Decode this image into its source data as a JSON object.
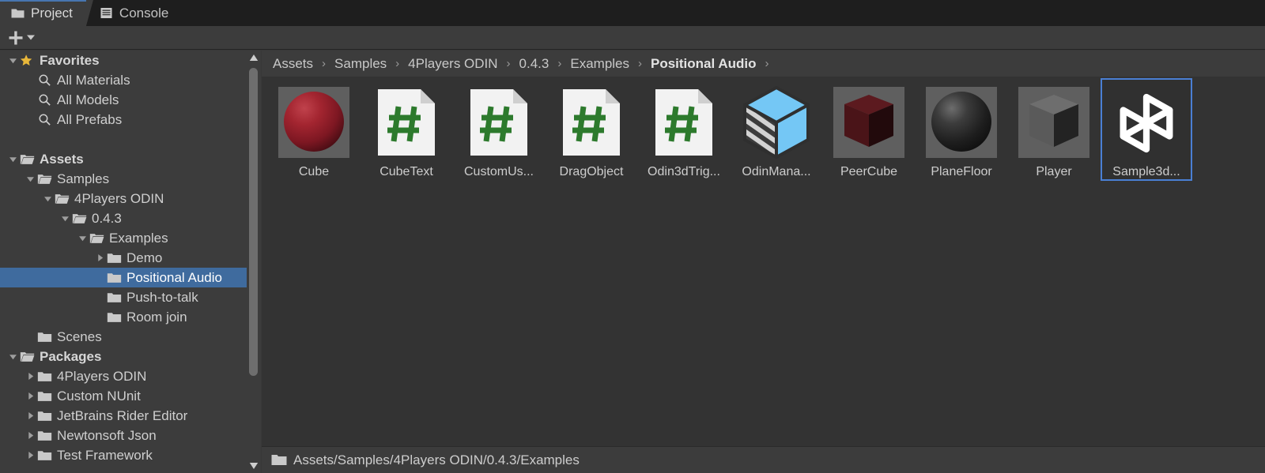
{
  "window": {
    "tabs": [
      {
        "label": "Project",
        "icon": "folder-icon",
        "active": true
      },
      {
        "label": "Console",
        "icon": "console-icon",
        "active": false
      }
    ]
  },
  "toolbar": {
    "add_label": "+",
    "add_icon": "plus-icon",
    "dropdown_icon": "chevron-down-icon",
    "search": {
      "value": "",
      "placeholder": "",
      "icon": "search-icon"
    }
  },
  "tree": {
    "items": [
      {
        "label": "Favorites",
        "indent": 0,
        "arrow": "down",
        "icon": "star-icon",
        "bold": true,
        "selected": false
      },
      {
        "label": "All Materials",
        "indent": 1,
        "arrow": "none",
        "icon": "search-icon",
        "bold": false,
        "selected": false
      },
      {
        "label": "All Models",
        "indent": 1,
        "arrow": "none",
        "icon": "search-icon",
        "bold": false,
        "selected": false
      },
      {
        "label": "All Prefabs",
        "indent": 1,
        "arrow": "none",
        "icon": "search-icon",
        "bold": false,
        "selected": false
      },
      {
        "label": "",
        "indent": 0,
        "arrow": "none",
        "icon": "none",
        "bold": false,
        "selected": false
      },
      {
        "label": "Assets",
        "indent": 0,
        "arrow": "down",
        "icon": "folder-open-icon",
        "bold": true,
        "selected": false
      },
      {
        "label": "Samples",
        "indent": 1,
        "arrow": "down",
        "icon": "folder-open-icon",
        "bold": false,
        "selected": false
      },
      {
        "label": "4Players ODIN",
        "indent": 2,
        "arrow": "down",
        "icon": "folder-open-icon",
        "bold": false,
        "selected": false
      },
      {
        "label": "0.4.3",
        "indent": 3,
        "arrow": "down",
        "icon": "folder-open-icon",
        "bold": false,
        "selected": false
      },
      {
        "label": "Examples",
        "indent": 4,
        "arrow": "down",
        "icon": "folder-open-icon",
        "bold": false,
        "selected": false
      },
      {
        "label": "Demo",
        "indent": 5,
        "arrow": "right",
        "icon": "folder-icon",
        "bold": false,
        "selected": false
      },
      {
        "label": "Positional Audio",
        "indent": 5,
        "arrow": "none",
        "icon": "folder-icon",
        "bold": false,
        "selected": true
      },
      {
        "label": "Push-to-talk",
        "indent": 5,
        "arrow": "none",
        "icon": "folder-icon",
        "bold": false,
        "selected": false
      },
      {
        "label": "Room join",
        "indent": 5,
        "arrow": "none",
        "icon": "folder-icon",
        "bold": false,
        "selected": false
      },
      {
        "label": "Scenes",
        "indent": 1,
        "arrow": "none",
        "icon": "folder-icon",
        "bold": false,
        "selected": false
      },
      {
        "label": "Packages",
        "indent": 0,
        "arrow": "down",
        "icon": "folder-open-icon",
        "bold": true,
        "selected": false
      },
      {
        "label": "4Players ODIN",
        "indent": 1,
        "arrow": "right",
        "icon": "folder-icon",
        "bold": false,
        "selected": false
      },
      {
        "label": "Custom NUnit",
        "indent": 1,
        "arrow": "right",
        "icon": "folder-icon",
        "bold": false,
        "selected": false
      },
      {
        "label": "JetBrains Rider Editor",
        "indent": 1,
        "arrow": "right",
        "icon": "folder-icon",
        "bold": false,
        "selected": false
      },
      {
        "label": "Newtonsoft Json",
        "indent": 1,
        "arrow": "right",
        "icon": "folder-icon",
        "bold": false,
        "selected": false
      },
      {
        "label": "Test Framework",
        "indent": 1,
        "arrow": "right",
        "icon": "folder-icon",
        "bold": false,
        "selected": false
      }
    ]
  },
  "breadcrumb": {
    "separator": "›",
    "items": [
      {
        "label": "Assets",
        "current": false
      },
      {
        "label": "Samples",
        "current": false
      },
      {
        "label": "4Players ODIN",
        "current": false
      },
      {
        "label": "0.4.3",
        "current": false
      },
      {
        "label": "Examples",
        "current": false
      },
      {
        "label": "Positional Audio",
        "current": true
      }
    ],
    "trailing_separator": "›"
  },
  "assets": [
    {
      "label": "Cube",
      "kind": "material-sphere-red",
      "selected": false
    },
    {
      "label": "CubeText",
      "kind": "csharp-script",
      "selected": false
    },
    {
      "label": "CustomUs...",
      "kind": "csharp-script",
      "selected": false
    },
    {
      "label": "DragObject",
      "kind": "csharp-script",
      "selected": false
    },
    {
      "label": "Odin3dTrig...",
      "kind": "csharp-script",
      "selected": false
    },
    {
      "label": "OdinMana...",
      "kind": "prefab-variant",
      "selected": false
    },
    {
      "label": "PeerCube",
      "kind": "mesh-cube-darkred",
      "selected": false
    },
    {
      "label": "PlaneFloor",
      "kind": "material-sphere-black",
      "selected": false
    },
    {
      "label": "Player",
      "kind": "mesh-cube-gray",
      "selected": false
    },
    {
      "label": "Sample3d...",
      "kind": "unity-scene",
      "selected": true
    }
  ],
  "statusbar": {
    "icon": "folder-icon",
    "path": "Assets/Samples/4Players ODIN/0.4.3/Examples"
  },
  "colors": {
    "selection_blue": "#3f6b9e",
    "selection_border": "#4a7fd4",
    "tab_accent": "#4775b0",
    "panel_bg": "#3c3c3c",
    "content_bg": "#333333",
    "script_green": "#2d7a2d"
  }
}
